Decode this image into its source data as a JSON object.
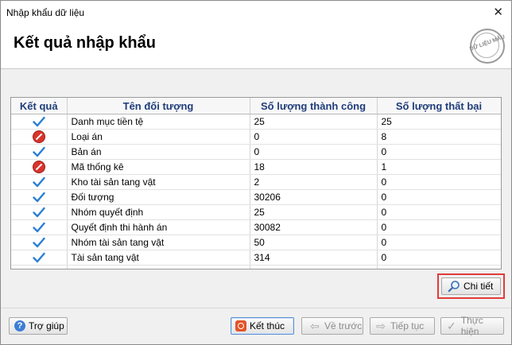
{
  "window": {
    "title": "Nhập khẩu dữ liệu",
    "close_glyph": "✕"
  },
  "header": {
    "heading": "Kết quả nhập khẩu",
    "stamp_text": "DỮ LIỆU MẪU"
  },
  "table": {
    "columns": [
      "Kết quả",
      "Tên đối tượng",
      "Số lượng thành công",
      "Số lượng thất bại"
    ],
    "rows": [
      {
        "status": "success",
        "name": "Danh mục tiền tệ",
        "success_count": "25",
        "fail_count": "25"
      },
      {
        "status": "error",
        "name": "Loại án",
        "success_count": "0",
        "fail_count": "8"
      },
      {
        "status": "success",
        "name": "Bản án",
        "success_count": "0",
        "fail_count": "0"
      },
      {
        "status": "error",
        "name": "Mã thống kê",
        "success_count": "18",
        "fail_count": "1"
      },
      {
        "status": "success",
        "name": "Kho tài sản tang vật",
        "success_count": "2",
        "fail_count": "0"
      },
      {
        "status": "success",
        "name": "Đối tượng",
        "success_count": "30206",
        "fail_count": "0"
      },
      {
        "status": "success",
        "name": "Nhóm quyết định",
        "success_count": "25",
        "fail_count": "0"
      },
      {
        "status": "success",
        "name": "Quyết định thi hành án",
        "success_count": "30082",
        "fail_count": "0"
      },
      {
        "status": "success",
        "name": "Nhóm tài sản tang vật",
        "success_count": "50",
        "fail_count": "0"
      },
      {
        "status": "success",
        "name": "Tài sản tang vật",
        "success_count": "314",
        "fail_count": "0"
      }
    ]
  },
  "buttons": {
    "detail": "Chi tiết",
    "help": "Trợ giúp",
    "finish": "Kết thúc",
    "back": "Về trước",
    "next": "Tiếp tục",
    "run": "Thực hiện"
  },
  "colors": {
    "header_text": "#1f3d7a",
    "highlight": "#e23b3b",
    "success_check": "#2a7fd4",
    "error_icon": "#d9342b"
  }
}
